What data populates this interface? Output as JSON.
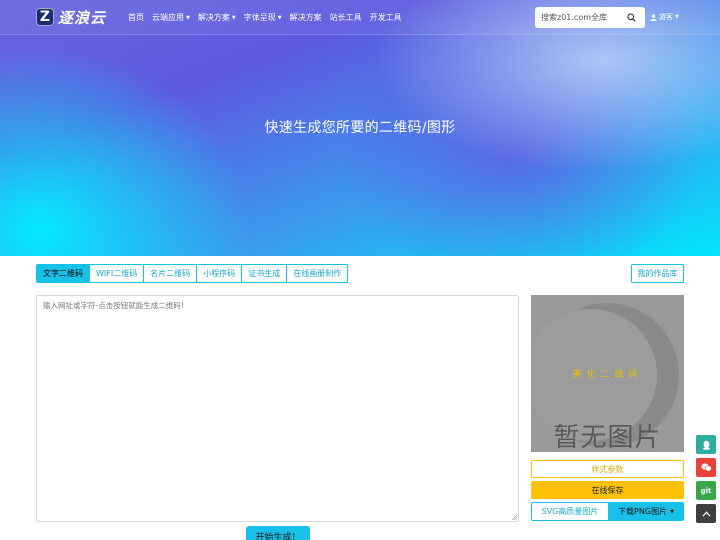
{
  "nav": {
    "brand": "逐浪云",
    "brand_mark": "Z",
    "items": [
      {
        "label": "首页",
        "dropdown": false
      },
      {
        "label": "云端应用",
        "dropdown": true
      },
      {
        "label": "解决方案",
        "dropdown": true
      },
      {
        "label": "字体呈现",
        "dropdown": true
      },
      {
        "label": "解决方案",
        "dropdown": false
      },
      {
        "label": "站长工具",
        "dropdown": false
      },
      {
        "label": "开发工具",
        "dropdown": false
      }
    ],
    "search_placeholder": "搜索z01.com全库",
    "user_label": "游客"
  },
  "hero": {
    "title": "快速生成您所要的二维码/图形"
  },
  "tabs": [
    {
      "label": "文字二维码",
      "active": true
    },
    {
      "label": "WIFI二维码",
      "active": false
    },
    {
      "label": "名片二维码",
      "active": false
    },
    {
      "label": "小程序码",
      "active": false
    },
    {
      "label": "证书生成",
      "active": false
    },
    {
      "label": "在线画册制作",
      "active": false
    }
  ],
  "works_button": "我的作品库",
  "editor": {
    "placeholder": "输入网址或字符-点击按钮就能生成二维码!"
  },
  "preview": {
    "label": "美化二维码",
    "empty_text": "暂无图片"
  },
  "buttons": {
    "style_params": "样式参数",
    "save_online": "在线保存",
    "svg_download": "SVG高质量图片",
    "png_download": "下载PNG图片",
    "generate": "开始生成！"
  },
  "side": {
    "git_label": "git"
  },
  "colors": {
    "accent": "#17c1e8",
    "warning": "#ffc107",
    "hero_start": "#6a66e0",
    "hero_end": "#00e5fa"
  }
}
